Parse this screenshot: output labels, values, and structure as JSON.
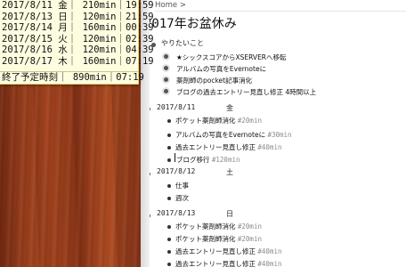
{
  "schedule": {
    "rows": [
      {
        "date": "2017/8/11",
        "day": "金",
        "minutes": "210min",
        "end": "19:59"
      },
      {
        "date": "2017/8/13",
        "day": "日",
        "minutes": "120min",
        "end": "21:59"
      },
      {
        "date": "2017/8/14",
        "day": "月",
        "minutes": "160min",
        "end": "00:39"
      },
      {
        "date": "2017/8/15",
        "day": "火",
        "minutes": "120min",
        "end": "02:39"
      },
      {
        "date": "2017/8/16",
        "day": "水",
        "minutes": "120min",
        "end": "04:39"
      },
      {
        "date": "2017/8/17",
        "day": "木",
        "minutes": "160min",
        "end": "07:19"
      }
    ],
    "total": {
      "label": "終了予定時刻",
      "minutes": "890min",
      "end": "07:19"
    }
  },
  "breadcrumb": {
    "home": "Home",
    "sep": ">"
  },
  "page_title": "2017年お盆休み",
  "outline": {
    "todo": {
      "label": "やりたいこと",
      "items": [
        "★シックスコアからXSERVERへ移転",
        "アルバムの写真をEvernoteに",
        "薬剤師のpocket記事消化",
        "ブログの過去エントリー見直し修正 4時間以上"
      ]
    },
    "days": [
      {
        "date": "2017/8/11",
        "dow": "金",
        "items": [
          {
            "text": "ポケット薬剤師消化",
            "tag": "#20min"
          },
          {
            "text": "アルバムの写真をEvernoteに",
            "tag": "#30min"
          },
          {
            "text": "過去エントリー見直し修正",
            "tag": "#40min"
          },
          {
            "text": "ブログ移行",
            "tag": "#120min"
          }
        ]
      },
      {
        "date": "2017/8/12",
        "dow": "土",
        "items": [
          {
            "text": "仕事",
            "tag": ""
          },
          {
            "text": "週次",
            "tag": ""
          }
        ]
      },
      {
        "date": "2017/8/13",
        "dow": "日",
        "items": [
          {
            "text": "ポケット薬剤師消化",
            "tag": "#20min"
          },
          {
            "text": "ポケット薬剤師消化",
            "tag": "#20min"
          },
          {
            "text": "過去エントリー見直し修正",
            "tag": "#40min"
          },
          {
            "text": "過去エントリー見直し修正",
            "tag": "#40min"
          }
        ]
      }
    ]
  }
}
